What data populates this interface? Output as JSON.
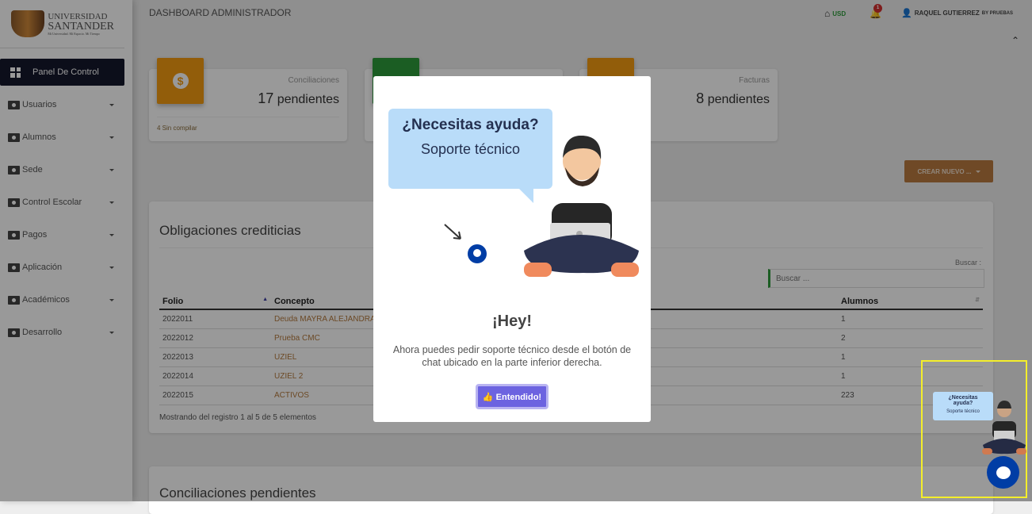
{
  "brand": {
    "line1": "UNIVERSIDAD",
    "line2": "SANTANDER",
    "tagline": "Mi Universidad. Mi Espacio. Mi Tiempo"
  },
  "sidebar": {
    "active": "Panel De Control",
    "items": [
      {
        "label": "Usuarios"
      },
      {
        "label": "Alumnos"
      },
      {
        "label": "Sede"
      },
      {
        "label": "Control Escolar"
      },
      {
        "label": "Pagos"
      },
      {
        "label": "Aplicación"
      },
      {
        "label": "Académicos"
      },
      {
        "label": "Desarrollo"
      }
    ]
  },
  "header": {
    "title": "DASHBOARD ADMINISTRADOR",
    "currency": "USD",
    "notifications": "1",
    "user": "RAQUEL GUTIERREZ",
    "user_suffix": "BY PRUEBAS"
  },
  "stats": [
    {
      "label": "Conciliaciones",
      "count": "17",
      "unit": "pendientes",
      "footer": "4 Sin compilar",
      "color": "#f39c12"
    },
    {
      "color": "#2e9b3b"
    },
    {
      "label": "Facturas",
      "count": "8",
      "unit": "pendientes",
      "color": "#f39c12"
    }
  ],
  "create_button": "CREAR NUEVO ...",
  "obligaciones": {
    "title": "Obligaciones crediticias",
    "search_label": "Buscar :",
    "search_placeholder": "Buscar ...",
    "columns": [
      "Folio",
      "Concepto",
      "Alumnos"
    ],
    "rows": [
      [
        "2022011",
        "Deuda MAYRA ALEJANDRA D",
        "1"
      ],
      [
        "2022012",
        "Prueba CMC",
        "2"
      ],
      [
        "2022013",
        "UZIEL",
        "1"
      ],
      [
        "2022014",
        "UZIEL 2",
        "1"
      ],
      [
        "2022015",
        "ACTIVOS",
        "223"
      ]
    ],
    "info": "Mostrando del registro 1 al 5 de 5 elementos"
  },
  "conciliaciones": {
    "title": "Conciliaciones pendientes"
  },
  "modal": {
    "bubble_question": "¿Necesitas ayuda?",
    "bubble_sub": "Soporte técnico",
    "title": "¡Hey!",
    "message": "Ahora puedes pedir soporte técnico desde el botón de chat ubicado en la parte inferior derecha.",
    "button": "Entendido!"
  },
  "widget": {
    "question": "¿Necesitas ayuda?",
    "sub": "Soporte técnico"
  }
}
